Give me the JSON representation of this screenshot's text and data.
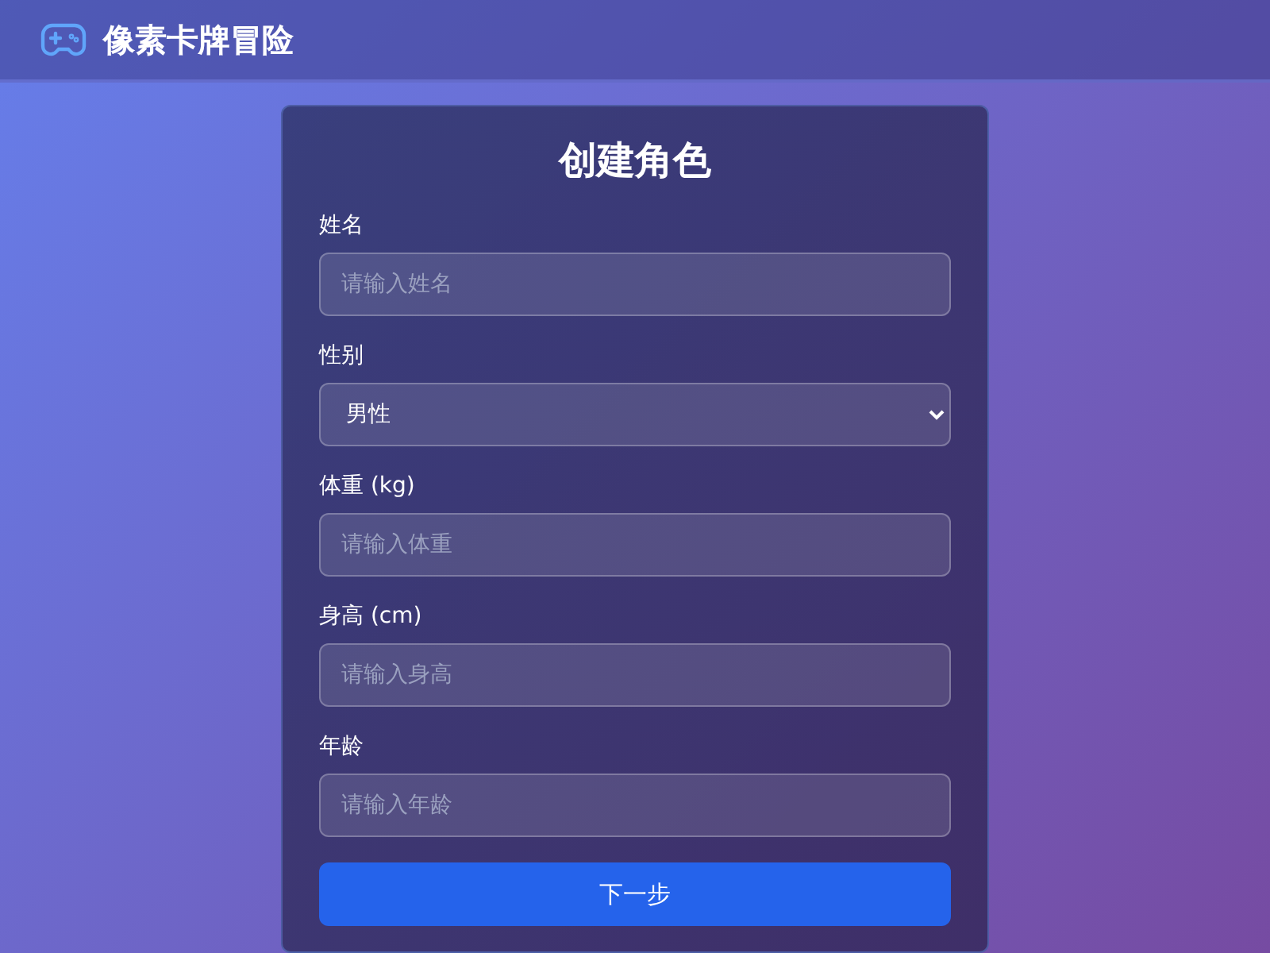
{
  "header": {
    "title": "像素卡牌冒险"
  },
  "form": {
    "title": "创建角色",
    "fields": [
      {
        "kind": "text",
        "label": "姓名",
        "placeholder": "请输入姓名"
      },
      {
        "kind": "select",
        "label": "性别",
        "value": "男性"
      },
      {
        "kind": "text",
        "label": "体重 (kg)",
        "placeholder": "请输入体重"
      },
      {
        "kind": "text",
        "label": "身高 (cm)",
        "placeholder": "请输入身高"
      },
      {
        "kind": "text",
        "label": "年龄",
        "placeholder": "请输入年龄"
      }
    ],
    "submit": "下一步"
  }
}
